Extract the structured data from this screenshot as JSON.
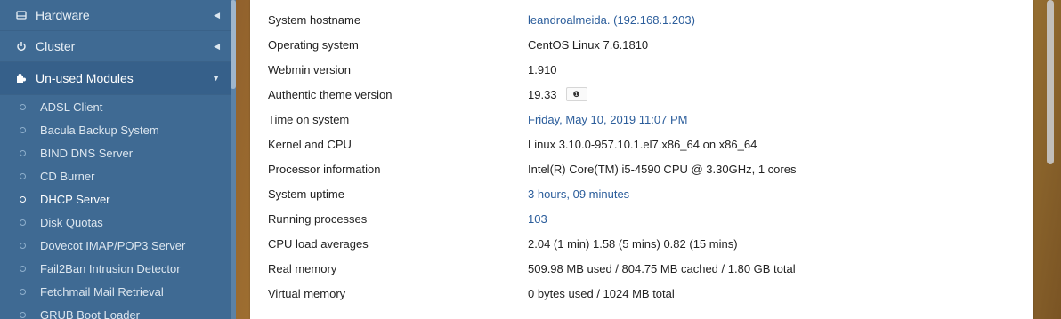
{
  "sidebar": {
    "categories": [
      {
        "label": "Hardware",
        "icon": "hardware-icon",
        "arrow": "◀"
      },
      {
        "label": "Cluster",
        "icon": "power-icon",
        "arrow": "◀"
      },
      {
        "label": "Un-used Modules",
        "icon": "puzzle-icon",
        "arrow": "▼"
      }
    ],
    "modules": [
      "ADSL Client",
      "Bacula Backup System",
      "BIND DNS Server",
      "CD Burner",
      "DHCP Server",
      "Disk Quotas",
      "Dovecot IMAP/POP3 Server",
      "Fail2Ban Intrusion Detector",
      "Fetchmail Mail Retrieval",
      "GRUB Boot Loader"
    ]
  },
  "system_info": {
    "rows": [
      {
        "label": "System hostname",
        "value": "leandroalmeida. (192.168.1.203)"
      },
      {
        "label": "Operating system",
        "value": "CentOS Linux 7.6.1810"
      },
      {
        "label": "Webmin version",
        "value": "1.910"
      },
      {
        "label": "Authentic theme version",
        "value": "19.33",
        "badge": "❶"
      },
      {
        "label": "Time on system",
        "value": "Friday, May 10, 2019 11:07 PM"
      },
      {
        "label": "Kernel and CPU",
        "value": "Linux 3.10.0-957.10.1.el7.x86_64 on x86_64"
      },
      {
        "label": "Processor information",
        "value": "Intel(R) Core(TM) i5-4590 CPU @ 3.30GHz, 1 cores"
      },
      {
        "label": "System uptime",
        "value": "3 hours, 09 minutes"
      },
      {
        "label": "Running processes",
        "value": "103"
      },
      {
        "label": "CPU load averages",
        "value": "2.04 (1 min) 1.58 (5 mins) 0.82 (15 mins)"
      },
      {
        "label": "Real memory",
        "value": "509.98 MB used / 804.75 MB cached / 1.80 GB total"
      },
      {
        "label": "Virtual memory",
        "value": "0 bytes used / 1024 MB total"
      }
    ]
  },
  "colors": {
    "sidebar": "#3f6a93",
    "link": "#2b5d9b"
  }
}
